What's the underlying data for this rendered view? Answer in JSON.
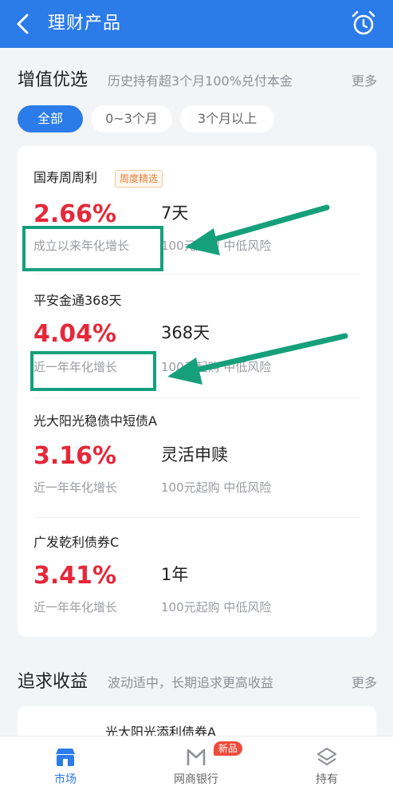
{
  "header": {
    "title": "理财产品"
  },
  "section1": {
    "title": "增值优选",
    "subtitle": "历史持有超3个月100%兑付本金",
    "more": "更多",
    "filters": [
      "全部",
      "0~3个月",
      "3个月以上"
    ]
  },
  "products": [
    {
      "name": "国寿周周利",
      "badge": "周度精选",
      "rate": "2.66%",
      "rate_label": "成立以来年化增长",
      "term": "7天",
      "info": "100元起购 中低风险"
    },
    {
      "name": "平安金通368天",
      "rate": "4.04%",
      "rate_label": "近一年年化增长",
      "term": "368天",
      "info": "100元起购 中低风险"
    },
    {
      "name": "光大阳光稳债中短债A",
      "rate": "3.16%",
      "rate_label": "近一年年化增长",
      "term": "灵活申赎",
      "info": "100元起购 中低风险"
    },
    {
      "name": "广发乾利债券C",
      "rate": "3.41%",
      "rate_label": "近一年年化增长",
      "term": "1年",
      "info": "100元起购 中低风险"
    }
  ],
  "section2": {
    "title": "追求收益",
    "subtitle": "波动适中，长期追求更高收益",
    "more": "更多",
    "first_product": "光大阳光添利债券A"
  },
  "tabbar": {
    "tabs": [
      {
        "label": "市场"
      },
      {
        "label": "网商银行",
        "badge": "新品"
      },
      {
        "label": "持有"
      }
    ]
  },
  "colors": {
    "header": "#2b7be9",
    "rate": "#e5283a",
    "highlight": "#15a07b"
  }
}
